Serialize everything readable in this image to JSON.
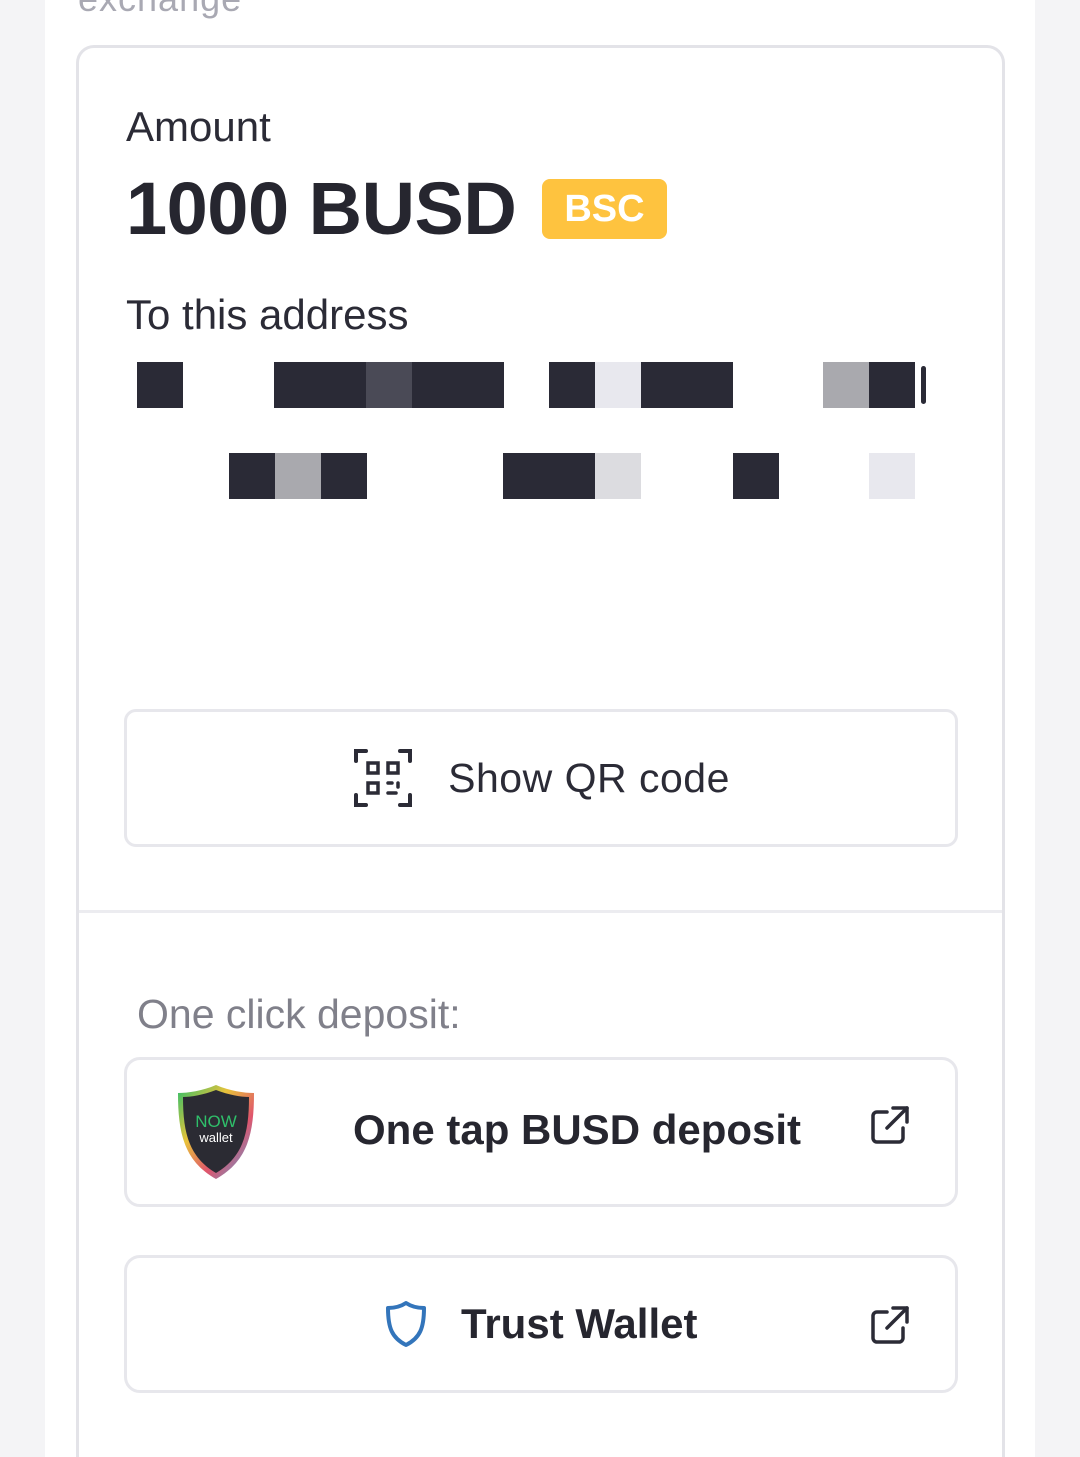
{
  "header": {
    "cut_title": "exchange"
  },
  "payment": {
    "amount_label": "Amount",
    "amount_value": "1000 BUSD",
    "network_badge": "BSC",
    "address_label": "To this address",
    "address_redacted": true
  },
  "qr": {
    "label": "Show QR code",
    "icon": "qr-code-icon"
  },
  "deposit": {
    "label": "One click deposit:",
    "options": [
      {
        "label": "One tap BUSD deposit",
        "logo": "now-wallet-logo",
        "logo_text_top": "NOW",
        "logo_text_bottom": "wallet",
        "icon": "external-link-icon"
      },
      {
        "label": "Trust Wallet",
        "logo": "shield-icon",
        "icon": "external-link-icon"
      }
    ]
  },
  "colors": {
    "badge": "#fec33f",
    "text_primary": "#2b2b36",
    "text_muted": "#80808a",
    "border": "#e7e7ec",
    "trust_blue": "#3375bb"
  }
}
